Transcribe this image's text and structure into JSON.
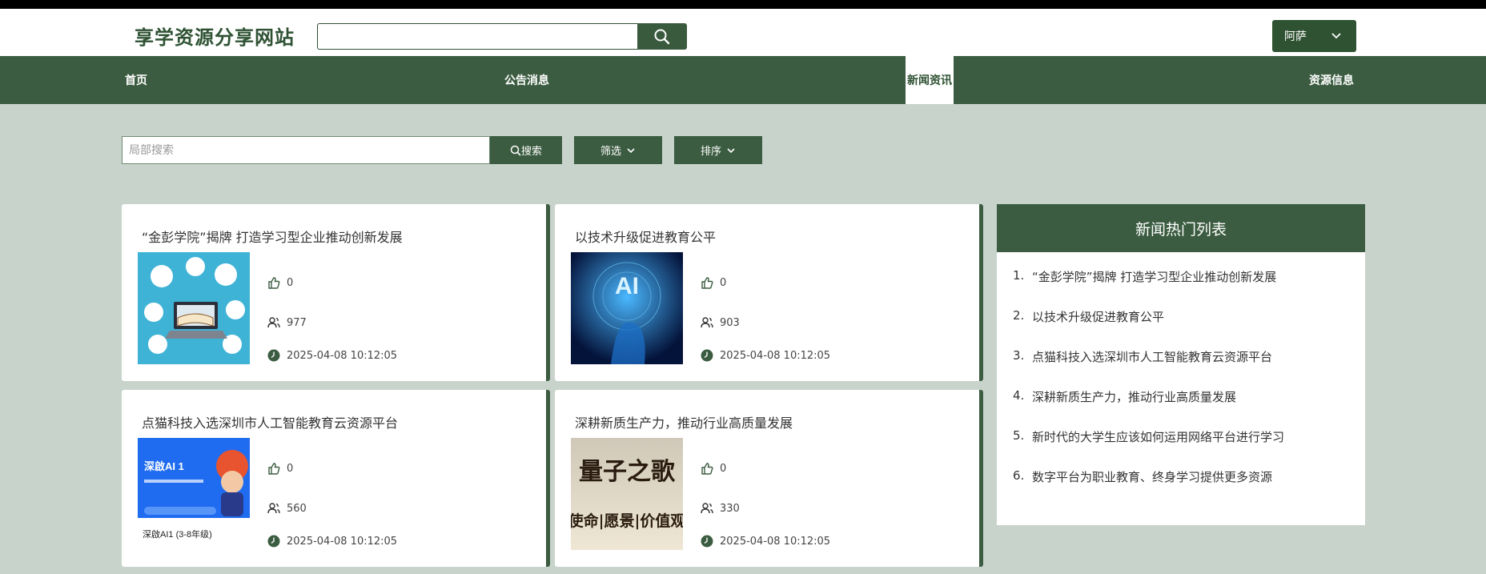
{
  "header": {
    "site_title": "享学资源分享网站",
    "search_placeholder": "",
    "user_name": "阿萨"
  },
  "nav": {
    "items": [
      {
        "label": "首页"
      },
      {
        "label": "公告消息"
      },
      {
        "label": "新闻资讯",
        "active": true
      },
      {
        "label": "资源信息"
      }
    ]
  },
  "filter": {
    "local_search_placeholder": "局部搜索",
    "search_button": "搜索",
    "filter_button": "筛选",
    "sort_button": "排序"
  },
  "news": [
    {
      "title": "“金彭学院”揭牌 打造学习型企业推动创新发展",
      "likes": "0",
      "views": "977",
      "date": "2025-04-08 10:12:05",
      "thumb": "online-education"
    },
    {
      "title": "以技术升级促进教育公平",
      "likes": "0",
      "views": "903",
      "date": "2025-04-08 10:12:05",
      "thumb": "ai-hand",
      "thumb_text": "AI"
    },
    {
      "title": "点猫科技入选深圳市人工智能教育云资源平台",
      "likes": "0",
      "views": "560",
      "date": "2025-04-08 10:12:05",
      "thumb": "deep-ai",
      "thumb_text": "深啟AI 1",
      "thumb_caption": "深啟AI1 (3-8年级)"
    },
    {
      "title": "深耕新质生产力，推动行业高质量发展",
      "likes": "0",
      "views": "330",
      "date": "2025-04-08 10:12:05",
      "thumb": "quantum-song",
      "thumb_line1": "量子之歌",
      "thumb_line2": "使命|愿景|价值观"
    }
  ],
  "hot_list": {
    "title": "新闻热门列表",
    "items": [
      {
        "num": "1.",
        "text": "“金彭学院”揭牌 打造学习型企业推动创新发展"
      },
      {
        "num": "2.",
        "text": "以技术升级促进教育公平"
      },
      {
        "num": "3.",
        "text": "点猫科技入选深圳市人工智能教育云资源平台"
      },
      {
        "num": "4.",
        "text": "深耕新质生产力，推动行业高质量发展"
      },
      {
        "num": "5.",
        "text": "新时代的大学生应该如何运用网络平台进行学习"
      },
      {
        "num": "6.",
        "text": "数字平台为职业教育、终身学习提供更多资源"
      }
    ]
  },
  "colors": {
    "brand_green": "#3b5c40",
    "background": "#c8d3cb"
  }
}
